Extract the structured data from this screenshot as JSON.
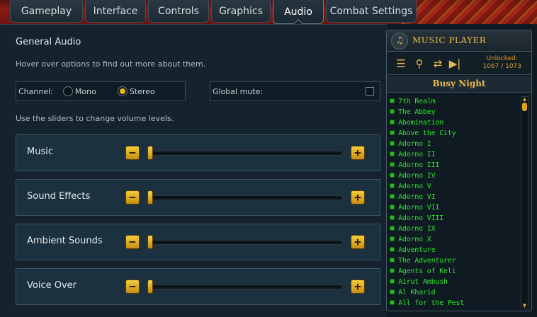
{
  "tabs": [
    {
      "label": "Gameplay"
    },
    {
      "label": "Interface"
    },
    {
      "label": "Controls"
    },
    {
      "label": "Graphics"
    },
    {
      "label": "Audio"
    },
    {
      "label": "Combat Settings"
    }
  ],
  "active_tab": "Audio",
  "general": {
    "heading": "General Audio",
    "hover_hint": "Hover over options to find out more about them.",
    "channel_label": "Channel:",
    "channel_options": [
      "Mono",
      "Stereo"
    ],
    "channel_selected": "Stereo",
    "global_mute_label": "Global mute:",
    "global_mute_checked": false,
    "slider_hint": "Use the sliders to change volume levels."
  },
  "sliders": [
    {
      "label": "Music",
      "value": 0
    },
    {
      "label": "Sound Effects",
      "value": 0
    },
    {
      "label": "Ambient Sounds",
      "value": 0
    },
    {
      "label": "Voice Over",
      "value": 0
    }
  ],
  "slider_minus": "−",
  "slider_plus": "+",
  "music_player": {
    "title": "MUSIC PLAYER",
    "unlocked_label": "Unlocked:",
    "unlocked_count": "1067 / 1073",
    "now_playing": "Busy Night",
    "tracks": [
      "7th Realm",
      "The Abbey",
      "Abomination",
      "Above the City",
      "Adorno I",
      "Adorno II",
      "Adorno III",
      "Adorno IV",
      "Adorno V",
      "Adorno VI",
      "Adorno VII",
      "Adorno VIII",
      "Adorno IX",
      "Adorno X",
      "Adventure",
      "The Adventurer",
      "Agents of Keli",
      "Airut Ambush",
      "Al Kharid",
      "All for the Pest"
    ],
    "colors": {
      "track": "#2ee52e",
      "accent": "#e9b949"
    }
  }
}
